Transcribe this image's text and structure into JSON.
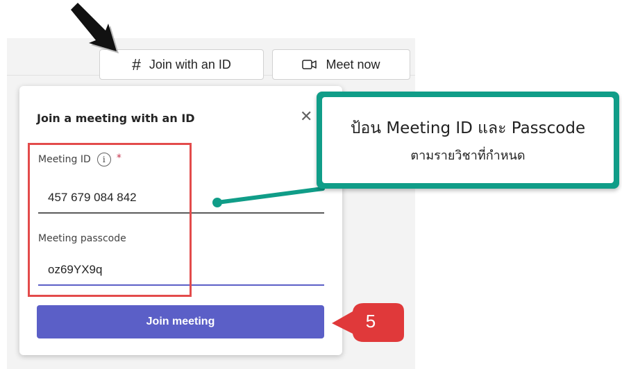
{
  "toolbar": {
    "join_with_id_label": "Join with an ID",
    "join_with_id_icon": "hash-icon",
    "meet_now_label": "Meet now",
    "meet_now_icon": "video-camera-icon"
  },
  "join_panel": {
    "title": "Join a meeting with an ID",
    "close_icon": "close-icon",
    "meeting_id": {
      "label": "Meeting ID",
      "info_icon": "info-icon",
      "required_marker": "*",
      "value": "457 679 084 842"
    },
    "passcode": {
      "label": "Meeting passcode",
      "value": "oz69YX9q"
    },
    "join_button_label": "Join meeting"
  },
  "annotations": {
    "callout_line1": "ป้อน Meeting ID และ Passcode",
    "callout_line2": "ตามรายวิชาที่กำหนด",
    "step_number": "5"
  },
  "colors": {
    "brand_purple": "#5b5fc7",
    "callout_teal": "#109d88",
    "highlight_red": "#e34b4b",
    "step_badge_red": "#e0393a",
    "required_red": "#c4314b"
  }
}
